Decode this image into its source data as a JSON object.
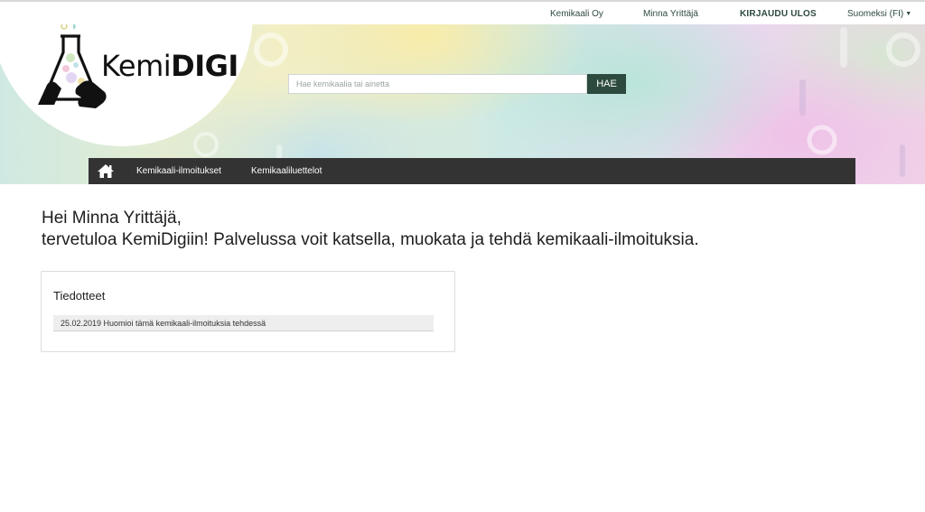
{
  "top_nav": {
    "company": "Kemikaali Oy",
    "user": "Minna Yrittäjä",
    "logout": "KIRJAUDU ULOS",
    "language": "Suomeksi (FI)"
  },
  "logo": {
    "kemi": "Kemi",
    "digi": "DIGI"
  },
  "search": {
    "placeholder": "Hae kemikaalia tai ainetta",
    "value": "",
    "button_label": "HAE"
  },
  "main_nav": {
    "home_icon": "home-icon",
    "items": [
      {
        "label": "Kemikaali-ilmoitukset"
      },
      {
        "label": "Kemikaaliluettelot"
      }
    ]
  },
  "welcome": {
    "line1": "Hei Minna Yrittäjä,",
    "line2": "tervetuloa KemiDigiin! Palvelussa voit katsella, muokata ja tehdä kemikaali-ilmoituksia."
  },
  "notices": {
    "title": "Tiedotteet",
    "items": [
      {
        "text": "25.02.2019 Huomioi tämä kemikaali-ilmoituksia tehdessä"
      }
    ]
  },
  "colors": {
    "brand_dark": "#2c4a3e",
    "nav_bar": "#333333"
  }
}
